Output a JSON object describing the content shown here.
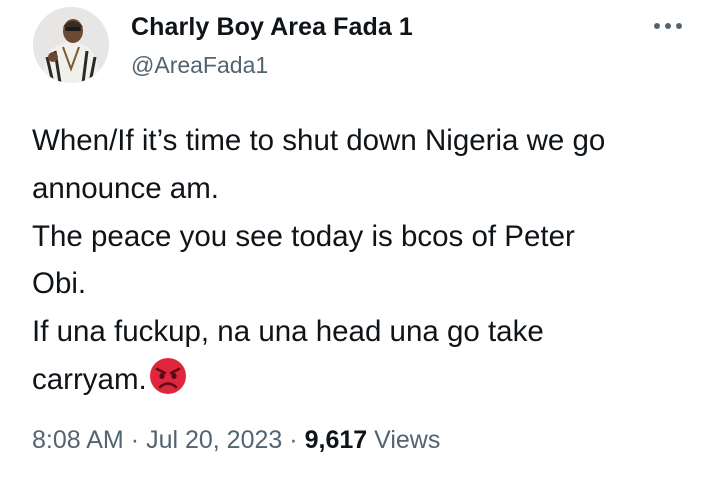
{
  "author": {
    "display_name": "Charly Boy Area Fada 1",
    "handle": "@AreaFada1",
    "avatar_icon": "profile-photo"
  },
  "menu": {
    "icon": "more-horizontal-icon"
  },
  "tweet": {
    "lines": [
      "When/If it’s time to shut down Nigeria we go",
      "announce am.",
      "The peace you see today is bcos of Peter",
      "Obi.",
      "If una fuckup, na una head una go take",
      "carryam."
    ],
    "emoji": "angry-face-emoji"
  },
  "meta": {
    "time": "8:08 AM",
    "separator": "·",
    "date": "Jul 20, 2023",
    "view_count": "9,617",
    "views_label": "Views"
  },
  "colors": {
    "text_primary": "#0f1419",
    "text_secondary": "#536471",
    "emoji_red": "#e0263d"
  }
}
